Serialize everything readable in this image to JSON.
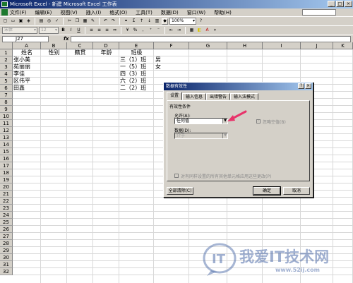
{
  "window": {
    "title": "Microsoft Excel - 新建 Microsoft Excel 工作表"
  },
  "menu": [
    "文件(F)",
    "编辑(E)",
    "视图(V)",
    "插入(I)",
    "格式(O)",
    "工具(T)",
    "数据(D)",
    "窗口(W)",
    "帮助(H)"
  ],
  "toolbar": {
    "zoom": "100%",
    "font": "宋体",
    "font_size": "12",
    "bold": "B",
    "italic": "I",
    "underline": "U",
    "sigma": "Σ",
    "currency": "%",
    "comma": ","
  },
  "formula_bar": {
    "name_box": "J27",
    "fx": "fx",
    "content": ""
  },
  "sheet": {
    "columns": [
      "A",
      "B",
      "C",
      "D",
      "E",
      "F",
      "G",
      "H",
      "I",
      "J",
      "K",
      "L"
    ],
    "rows": [
      "1",
      "2",
      "3",
      "4",
      "5",
      "6",
      "7",
      "8",
      "9",
      "10",
      "11",
      "12",
      "13",
      "14",
      "15",
      "16",
      "17",
      "18",
      "19",
      "20",
      "21",
      "22",
      "23",
      "24",
      "25",
      "26",
      "27",
      "28",
      "29",
      "30",
      "31",
      "32"
    ],
    "headers": {
      "a1": "姓名",
      "b1": "性别",
      "c1": "籍贯",
      "d1": "年龄",
      "e1": "班级"
    },
    "names": [
      "张小美",
      "苑丽丽",
      "李佳",
      "区伟平",
      "田鑫"
    ],
    "classes": [
      "三（1）班",
      "一（5）班",
      "四（3）班",
      "六（2）班",
      "二（2）班"
    ],
    "genders": [
      "男",
      "女"
    ]
  },
  "dialog": {
    "title": "数据有效性",
    "help": "?",
    "close": "×",
    "tabs": [
      "设置",
      "输入信息",
      "出错警告",
      "输入法模式"
    ],
    "section": "有效性条件",
    "allow_label": "允许(A):",
    "allow_value": "任何值",
    "ignore_blank": "忽略空值(B)",
    "data_label": "数据(D):",
    "data_value": "介于",
    "apply_all": "对有同样设置的所有其他单元格应用这些更改(P)",
    "clear_all": "全部清除(C)",
    "ok": "确定",
    "cancel": "取消"
  },
  "watermark": {
    "text": "我爱IT技术网",
    "url": "www.52ij.com"
  },
  "colors": {
    "title_bar": "#0a246a",
    "arrow": "#e8336a",
    "watermark": "#506eaa",
    "chrome": "#d4d0c8"
  }
}
